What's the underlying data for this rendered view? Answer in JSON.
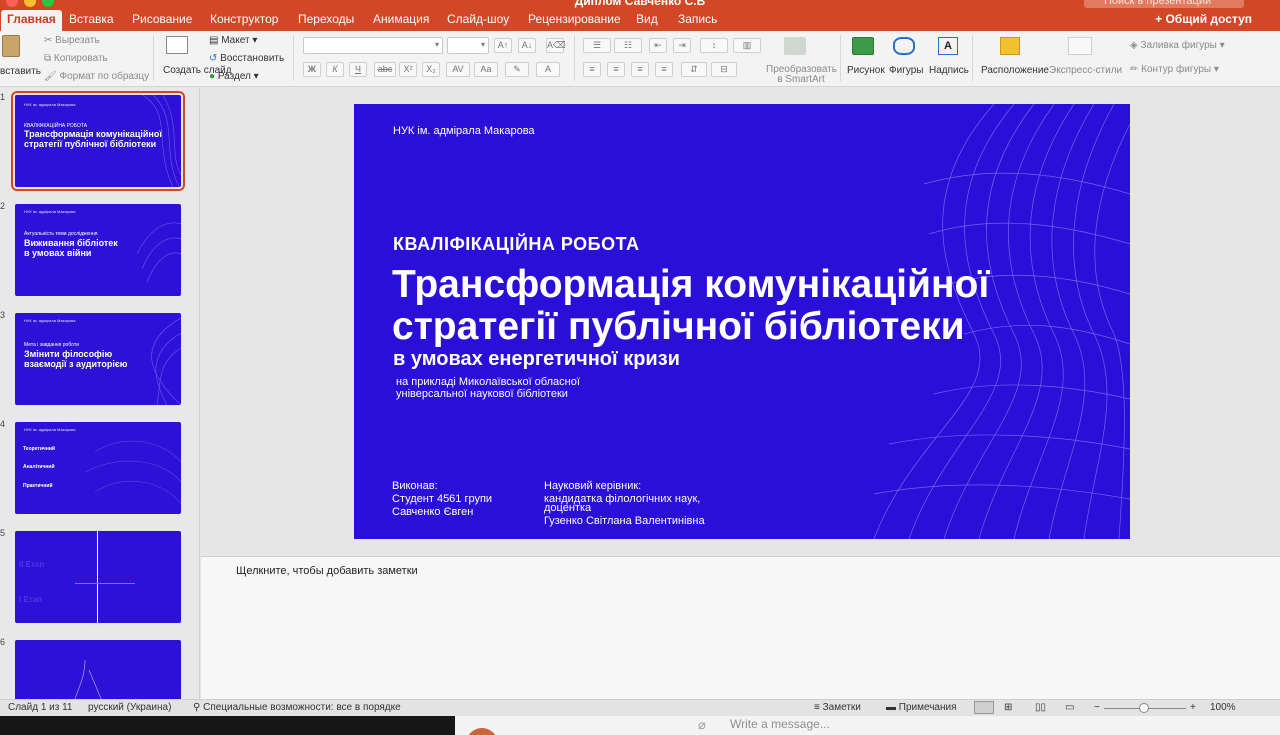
{
  "app": {
    "title": "Диплом Савченко С.В",
    "search_placeholder": "Поиск в презентации",
    "accent": "#d24726"
  },
  "tabs": [
    {
      "label": "Главная",
      "active": true
    },
    {
      "label": "Вставка"
    },
    {
      "label": "Рисование"
    },
    {
      "label": "Конструктор"
    },
    {
      "label": "Переходы"
    },
    {
      "label": "Анимация"
    },
    {
      "label": "Слайд-шоу"
    },
    {
      "label": "Рецензирование"
    },
    {
      "label": "Вид"
    },
    {
      "label": "Запись"
    }
  ],
  "share": "Общий доступ",
  "ribbon": {
    "paste": "вставить",
    "cut": "Вырезать",
    "copy": "Копировать",
    "format_painter": "Формат по образцу",
    "new_slide": "Создать слайд",
    "layout": "Макет",
    "reset": "Восстановить",
    "section": "Раздел",
    "convert_smartart": "Преобразовать в SmartArt",
    "picture": "Рисунок",
    "shapes": "Фигуры",
    "textbox": "Надпись",
    "arrange": "Расположение",
    "quick_styles": "Экспресс-стили",
    "shape_fill": "Заливка фигуры",
    "shape_outline": "Контур фигуры"
  },
  "thumbnails": [
    {
      "num": "1",
      "header": "НУК ім. адмірала Макарова",
      "kicker": "КВАЛІФІКАЦІЙНА РОБОТА",
      "title1": "Трансформація комунікаційної",
      "title2": "стратегії публічної бібліотеки",
      "selected": true
    },
    {
      "num": "2",
      "header": "НУК ім. адмірала Макарова",
      "kicker": "Актуальність теми дослідження",
      "title1": "Виживання бібліотек",
      "title2": "в умовах війни"
    },
    {
      "num": "3",
      "header": "НУК ім. адмірала Макарова",
      "kicker": "Мета і завдання роботи",
      "title1": "Змінити філософію",
      "title2": "взаємодії з аудиторією"
    },
    {
      "num": "4",
      "header": "НУК ім. адмірала Макарова",
      "kicker": "Теоретичний",
      "title1": "Аналітичний",
      "title2": "Практичний"
    },
    {
      "num": "5",
      "header": "",
      "kicker": "ІІ Етап",
      "title1": "І Етап",
      "title2": ""
    },
    {
      "num": "6",
      "header": "",
      "kicker": "",
      "title1": "",
      "title2": ""
    }
  ],
  "slide": {
    "university": "НУК ім. адмірала Макарова",
    "kicker": "КВАЛІФІКАЦІЙНА РОБОТА",
    "title_line1": "Трансформація комунікаційної",
    "title_line2": "стратегії публічної бібліотеки",
    "subtitle": "в умовах енергетичної кризи",
    "example_line1": "на прикладі Миколаївської обласної",
    "example_line2": "універсальної наукової бібліотеки",
    "author_label": "Виконав:",
    "author_group": "Студент 4561 групи",
    "author_name": "Савченко Євген",
    "supervisor_label": "Науковий керівник:",
    "supervisor_degree1": "кандидатка філологічних наук,",
    "supervisor_degree2": "доцентка",
    "supervisor_name": "Гузенко Світлана Валентинівна",
    "background": "#2a0fd8"
  },
  "notes_placeholder": "Щелкните, чтобы добавить заметки",
  "status": {
    "slide_counter": "Слайд 1 из 11",
    "language": "русский (Украина)",
    "accessibility": "Специальные возможности: все в порядке",
    "notes": "Заметки",
    "comments": "Примечания",
    "zoom": "100%"
  },
  "bottom_message": "Write a message..."
}
